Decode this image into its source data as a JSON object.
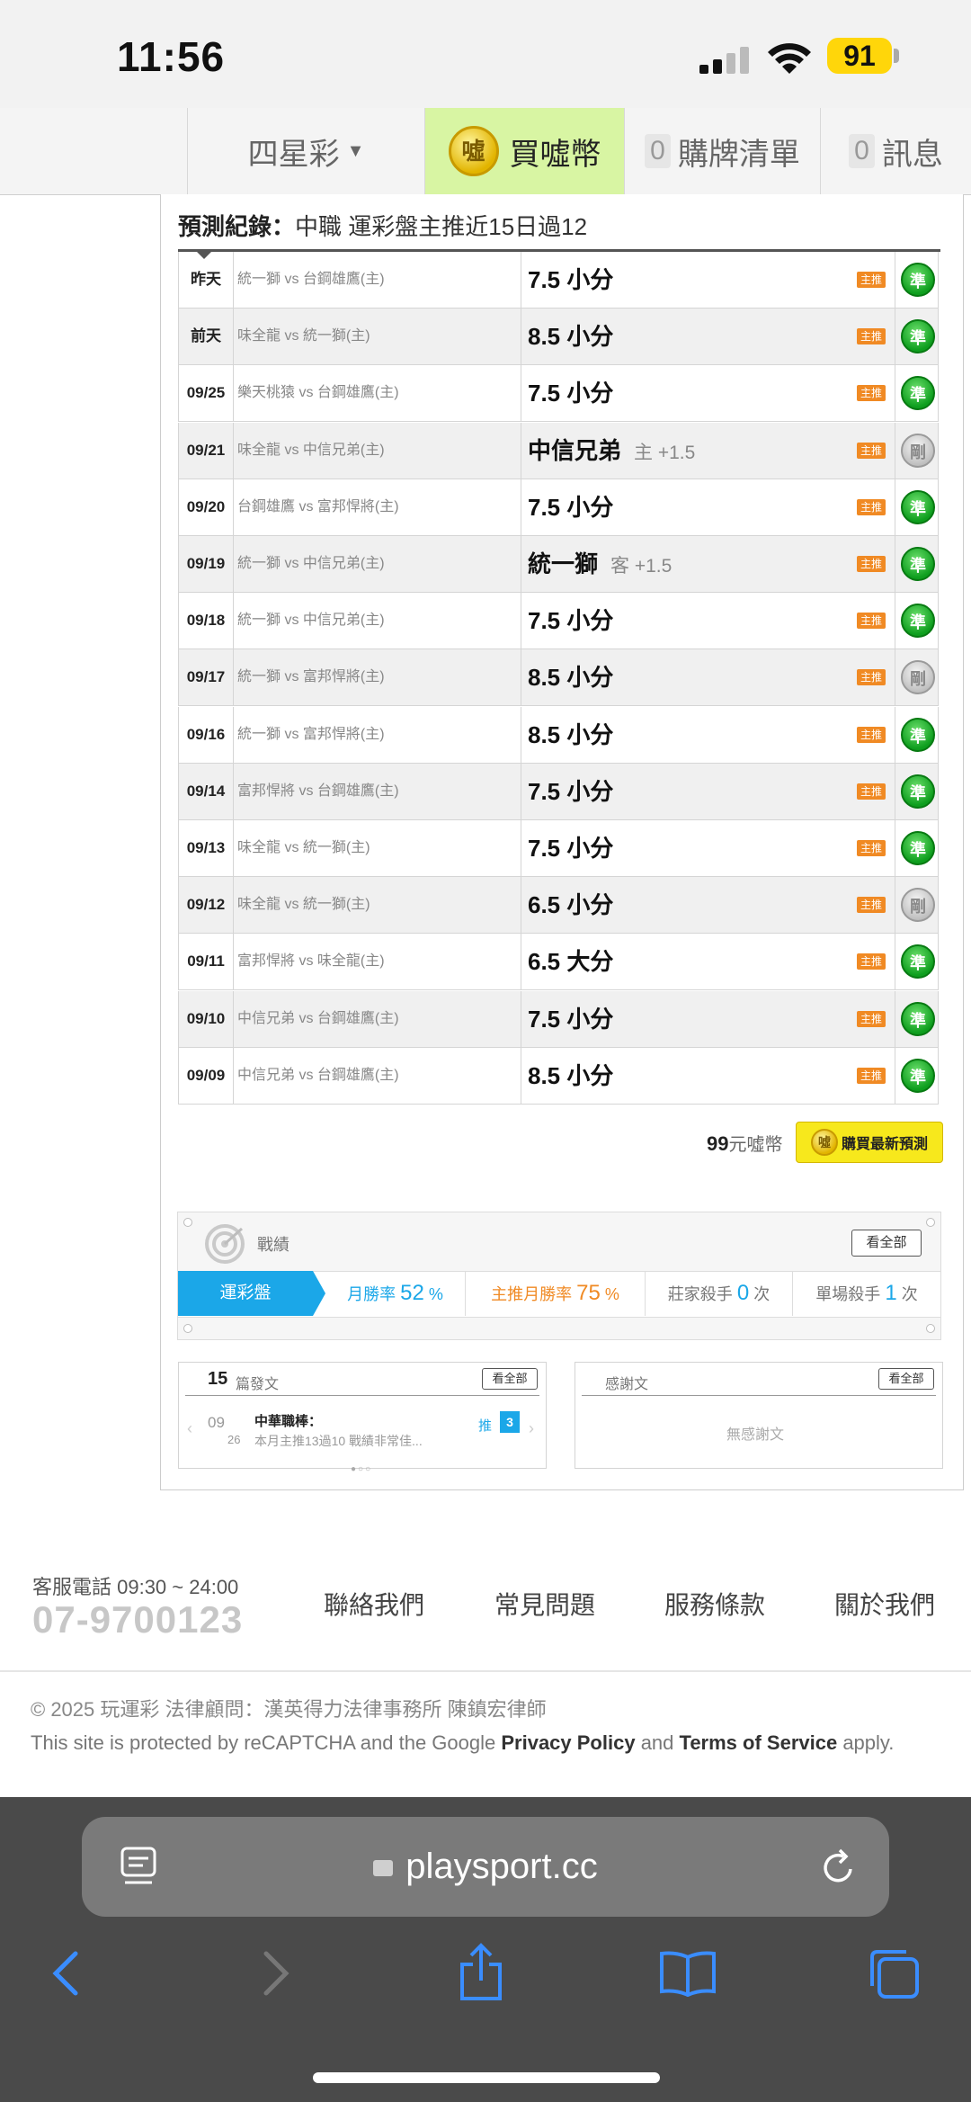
{
  "status": {
    "time": "11:56",
    "battery": "91"
  },
  "nav": {
    "game": "四星彩",
    "buy": "買噓幣",
    "coin": "噓",
    "cart_count": "0",
    "cart": "購牌清單",
    "msg_count": "0",
    "msg": "訊息"
  },
  "record": {
    "title_bold": "預測紀錄：",
    "title_rest": "中職 運彩盤主推近15日過12",
    "rows": [
      {
        "date": "昨天",
        "match": "統一獅 vs 台鋼雄鷹(主)",
        "pick": "7.5 小分",
        "sub": "",
        "tag": "主推",
        "result": "準",
        "win": true
      },
      {
        "date": "前天",
        "match": "味全龍 vs 統一獅(主)",
        "pick": "8.5 小分",
        "sub": "",
        "tag": "主推",
        "result": "準",
        "win": true
      },
      {
        "date": "09/25",
        "match": "樂天桃猿 vs 台鋼雄鷹(主)",
        "pick": "7.5 小分",
        "sub": "",
        "tag": "主推",
        "result": "準",
        "win": true
      },
      {
        "date": "09/21",
        "match": "味全龍 vs 中信兄弟(主)",
        "pick": "中信兄弟",
        "sub": "主 +1.5",
        "tag": "主推",
        "result": "剛",
        "win": false
      },
      {
        "date": "09/20",
        "match": "台鋼雄鷹 vs 富邦悍將(主)",
        "pick": "7.5 小分",
        "sub": "",
        "tag": "主推",
        "result": "準",
        "win": true
      },
      {
        "date": "09/19",
        "match": "統一獅 vs 中信兄弟(主)",
        "pick": "統一獅",
        "sub": "客 +1.5",
        "tag": "主推",
        "result": "準",
        "win": true
      },
      {
        "date": "09/18",
        "match": "統一獅 vs 中信兄弟(主)",
        "pick": "7.5 小分",
        "sub": "",
        "tag": "主推",
        "result": "準",
        "win": true
      },
      {
        "date": "09/17",
        "match": "統一獅 vs 富邦悍將(主)",
        "pick": "8.5 小分",
        "sub": "",
        "tag": "主推",
        "result": "剛",
        "win": false
      },
      {
        "date": "09/16",
        "match": "統一獅 vs 富邦悍將(主)",
        "pick": "8.5 小分",
        "sub": "",
        "tag": "主推",
        "result": "準",
        "win": true
      },
      {
        "date": "09/14",
        "match": "富邦悍將 vs 台鋼雄鷹(主)",
        "pick": "7.5 小分",
        "sub": "",
        "tag": "主推",
        "result": "準",
        "win": true
      },
      {
        "date": "09/13",
        "match": "味全龍 vs 統一獅(主)",
        "pick": "7.5 小分",
        "sub": "",
        "tag": "主推",
        "result": "準",
        "win": true
      },
      {
        "date": "09/12",
        "match": "味全龍 vs 統一獅(主)",
        "pick": "6.5 小分",
        "sub": "",
        "tag": "主推",
        "result": "剛",
        "win": false
      },
      {
        "date": "09/11",
        "match": "富邦悍將 vs 味全龍(主)",
        "pick": "6.5 大分",
        "sub": "",
        "tag": "主推",
        "result": "準",
        "win": true
      },
      {
        "date": "09/10",
        "match": "中信兄弟 vs 台鋼雄鷹(主)",
        "pick": "7.5 小分",
        "sub": "",
        "tag": "主推",
        "result": "準",
        "win": true
      },
      {
        "date": "09/09",
        "match": "中信兄弟 vs 台鋼雄鷹(主)",
        "pick": "8.5 小分",
        "sub": "",
        "tag": "主推",
        "result": "準",
        "win": true
      }
    ]
  },
  "buy": {
    "price_num": "99",
    "price_unit": "元噓幣",
    "button": "購買最新預測",
    "coin": "噓"
  },
  "stats": {
    "label": "戰績",
    "see_all": "看全部",
    "tab": "運彩盤",
    "month_rate_label": "月勝率",
    "month_rate": "52",
    "top_rate_label": "主推月勝率",
    "top_rate": "75",
    "pct": "%",
    "house_label": "莊家殺手",
    "house": "0",
    "single_label": "單場殺手",
    "single": "1",
    "times": "次"
  },
  "posts": {
    "count": "15",
    "label": "篇發文",
    "see_all": "看全部",
    "month": "09",
    "day": "26",
    "title": "中華職棒：",
    "snippet": "本月主推13過10 戰績非常佳...",
    "push_label": "推",
    "push_count": "3",
    "pager": "●○○"
  },
  "thanks": {
    "label": "感謝文",
    "see_all": "看全部",
    "empty": "無感謝文"
  },
  "footer": {
    "cs_label": "客服電話 09:30 ~ 24:00",
    "cs_phone": "07-9700123",
    "links": [
      "聯絡我們",
      "常見問題",
      "服務條款",
      "關於我們"
    ],
    "copyright": "© 2025 玩運彩 法律顧問：漢英得力法律事務所 陳鎮宏律師",
    "recaptcha_a": "This site is protected by reCAPTCHA and the Google ",
    "privacy": "Privacy Policy",
    "recaptcha_b": " and ",
    "terms": "Terms of Service",
    "recaptcha_c": " apply."
  },
  "browser": {
    "url": "playsport.cc"
  },
  "colors": {
    "win": "#0e9e1e",
    "push": "#bdbdbd",
    "tag": "#f08a24",
    "accent": "#1ba7e8",
    "buy_bg": "#d8f5a3",
    "battery": "#ffd60a"
  }
}
